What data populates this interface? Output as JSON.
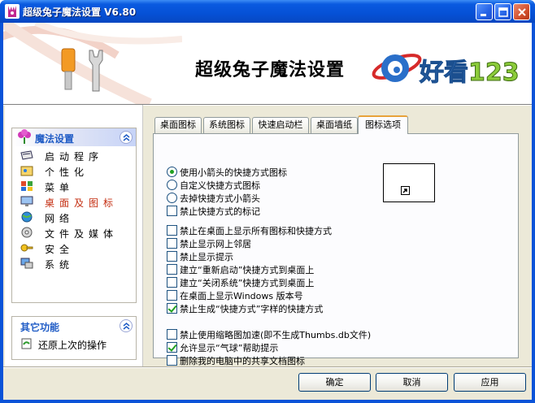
{
  "window": {
    "title": "超级兔子魔法设置 V6.80"
  },
  "banner": {
    "title": "超级兔子魔法设置",
    "logo_text": "好看",
    "logo_number": "123"
  },
  "sidebar": {
    "magic_group_title": "魔法设置",
    "items": [
      {
        "label": "启动程序",
        "icon": "startup-icon",
        "active": false
      },
      {
        "label": "个性化",
        "icon": "personalize-icon",
        "active": false
      },
      {
        "label": "菜单",
        "icon": "menu-icon",
        "active": false
      },
      {
        "label": "桌面及图标",
        "icon": "desktop-icons-icon",
        "active": true
      },
      {
        "label": "网络",
        "icon": "network-icon",
        "active": false
      },
      {
        "label": "文件及媒体",
        "icon": "file-media-icon",
        "active": false
      },
      {
        "label": "安全",
        "icon": "security-icon",
        "active": false
      },
      {
        "label": "系统",
        "icon": "system-icon",
        "active": false
      }
    ],
    "other_group_title": "其它功能",
    "other_items": [
      {
        "label": "还原上次的操作",
        "icon": "restore-icon"
      }
    ]
  },
  "tabs": [
    {
      "label": "桌面图标",
      "active": false
    },
    {
      "label": "系统图标",
      "active": false
    },
    {
      "label": "快速启动栏",
      "active": false
    },
    {
      "label": "桌面墙纸",
      "active": false
    },
    {
      "label": "图标选项",
      "active": true
    }
  ],
  "options": {
    "radios": [
      {
        "label": "使用小箭头的快捷方式图标",
        "checked": true
      },
      {
        "label": "自定义快捷方式图标",
        "checked": false
      },
      {
        "label": "去掉快捷方式小箭头",
        "checked": false
      }
    ],
    "check_group_1": [
      {
        "label": "禁止快捷方式的标记",
        "checked": false
      }
    ],
    "check_group_2": [
      {
        "label": "禁止在桌面上显示所有图标和快捷方式",
        "checked": false
      },
      {
        "label": "禁止显示网上邻居",
        "checked": false
      },
      {
        "label": "禁止显示提示",
        "checked": false
      },
      {
        "label": "建立“重新启动”快捷方式到桌面上",
        "checked": false
      },
      {
        "label": "建立“关闭系统”快捷方式到桌面上",
        "checked": false
      },
      {
        "label": "在桌面上显示Windows 版本号",
        "checked": false
      },
      {
        "label": "禁止生成“快捷方式”字样的快捷方式",
        "checked": true
      }
    ],
    "check_group_3": [
      {
        "label": "禁止使用缩略图加速(即不生成Thumbs.db文件)",
        "checked": false
      },
      {
        "label": "允许显示“气球”帮助提示",
        "checked": true
      },
      {
        "label": "删除我的电脑中的共享文档图标",
        "checked": false
      }
    ]
  },
  "buttons": {
    "ok": "确定",
    "cancel": "取消",
    "apply": "应用"
  },
  "colors": {
    "titlebar": "#0551d6",
    "active_nav": "#c42d10",
    "group_header_text": "#215dc6",
    "check_mark": "#21a121",
    "active_tab_accent": "#e8a23a"
  }
}
